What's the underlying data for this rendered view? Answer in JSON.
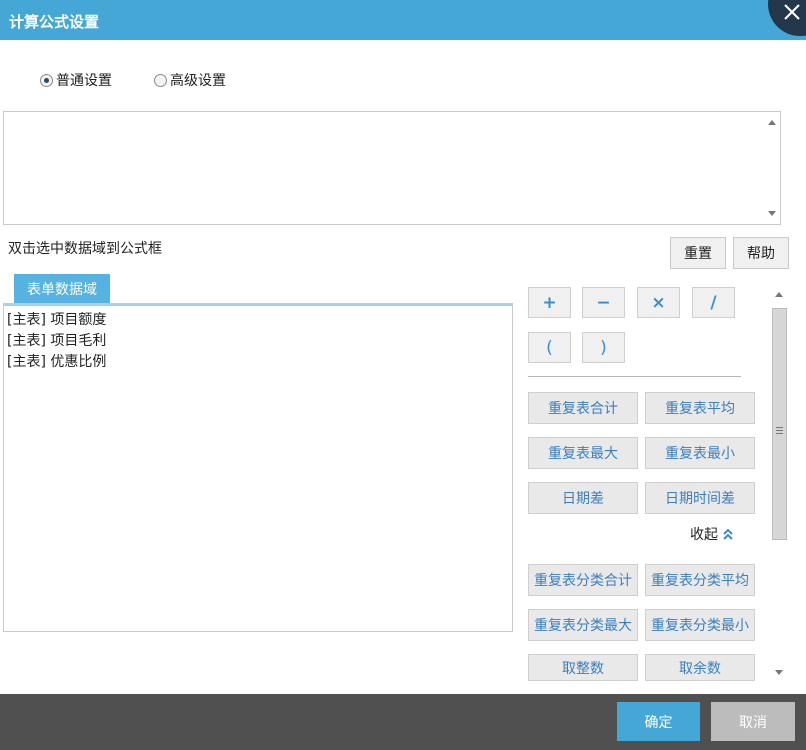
{
  "window": {
    "title": "计算公式设置"
  },
  "mode": {
    "options": [
      "普通设置",
      "高级设置"
    ],
    "selected": "普通设置"
  },
  "formula": {
    "value": ""
  },
  "hint": "双击选中数据域到公式框",
  "toolbar": {
    "reset_label": "重置",
    "help_label": "帮助"
  },
  "tab": {
    "label": "表单数据域"
  },
  "fields": [
    "[主表] 项目额度",
    "[主表] 项目毛利",
    "[主表] 优惠比例"
  ],
  "operators": [
    "+",
    "−",
    "×",
    "/",
    "(",
    ")"
  ],
  "functions": [
    "重复表合计",
    "重复表平均",
    "重复表最大",
    "重复表最小",
    "日期差",
    "日期时间差"
  ],
  "collapse_label": "收起",
  "more_functions": [
    "重复表分类合计",
    "重复表分类平均",
    "重复表分类最大",
    "重复表分类最小",
    "取整数",
    "取余数"
  ],
  "footer": {
    "ok_label": "确定",
    "cancel_label": "取消"
  },
  "colors": {
    "accent": "#45a7d6",
    "footer": "#505050",
    "close_bg": "#24374a",
    "function_text": "#3a7fc0"
  }
}
